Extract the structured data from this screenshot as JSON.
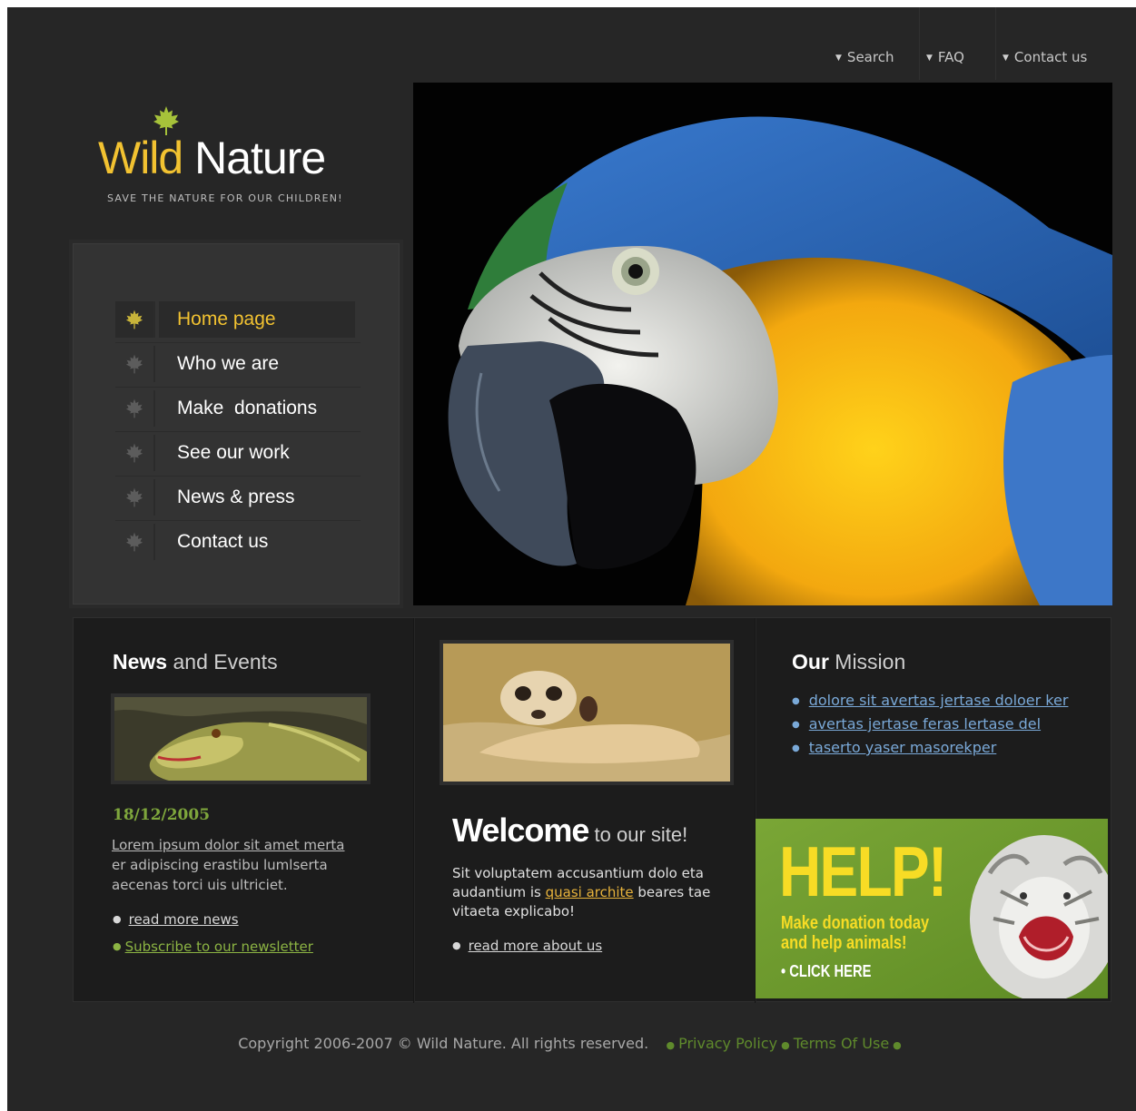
{
  "top_nav": {
    "items": [
      {
        "label": "Search"
      },
      {
        "label": "FAQ"
      },
      {
        "label": "Contact us"
      }
    ]
  },
  "logo": {
    "word1": "Wild",
    "word2": "Nature",
    "tagline": "SAVE THE NATURE FOR OUR CHILDREN!"
  },
  "menu": {
    "items": [
      {
        "label": "Home page",
        "active": true
      },
      {
        "label": "Who we are"
      },
      {
        "label": "Make  donations"
      },
      {
        "label": "See our work"
      },
      {
        "label": "News & press"
      },
      {
        "label": "Contact us"
      }
    ]
  },
  "news": {
    "title_bold": "News",
    "title_rest": " and Events",
    "date": "18/12/2005",
    "text_link": "Lorem ipsum dolor sit amet merta",
    "text_rest": " er adipiscing erastibu lumlserta aecenas torci uis ultriciet.",
    "read_more": "read more news",
    "subscribe": "Subscribe to our newsletter"
  },
  "welcome": {
    "big": "Welcome",
    "small": " to our site!",
    "text_a": "Sit voluptatem accusantium dolo eta audantium is ",
    "text_highlight": "quasi archite",
    "text_b": " beares tae vitaeta explicabo!",
    "read_more": "read more about us"
  },
  "mission": {
    "title_bold": "Our",
    "title_rest": " Mission",
    "items": [
      "dolore sit avertas jertase doloer ker",
      "avertas jertase feras lertase del",
      "taserto yaser masorekper"
    ]
  },
  "help_banner": {
    "title": "HELP!",
    "line1": "Make donation today",
    "line2": "and help animals!",
    "cta": "• CLICK HERE"
  },
  "footer": {
    "copyright": "Copyright 2006-2007 © Wild Nature. All rights reserved.",
    "privacy": "Privacy Policy",
    "terms": "Terms Of Use"
  },
  "colors": {
    "accent_yellow": "#f2c231",
    "accent_green": "#7ea63c",
    "link_blue": "#7aa9d8",
    "background": "#262626"
  }
}
